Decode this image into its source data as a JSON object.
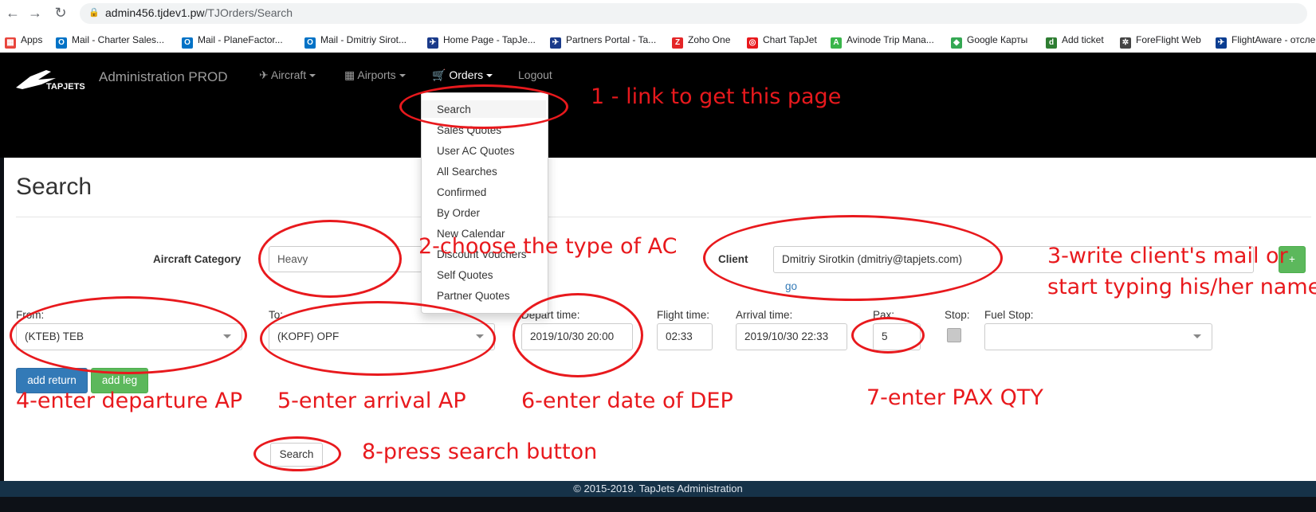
{
  "browser": {
    "url_host": "admin456.tjdev1.pw",
    "url_path": "/TJOrders/Search",
    "bookmarks": [
      {
        "label": "Apps",
        "icon": "apps-grid-icon",
        "color": "#e8453c"
      },
      {
        "label": "Mail - Charter Sales...",
        "icon": "outlook-icon",
        "color": "#0072c6"
      },
      {
        "label": "Mail - PlaneFactor...",
        "icon": "outlook-icon",
        "color": "#0072c6"
      },
      {
        "label": "Mail - Dmitriy Sirot...",
        "icon": "outlook-icon",
        "color": "#0072c6"
      },
      {
        "label": "Home Page - TapJe...",
        "icon": "tapjets-icon",
        "color": "#1a3a8a"
      },
      {
        "label": "Partners Portal - Ta...",
        "icon": "tapjets-icon",
        "color": "#1a3a8a"
      },
      {
        "label": "Zoho One",
        "icon": "zoho-icon",
        "color": "#e42527"
      },
      {
        "label": "Chart TapJet",
        "icon": "chart-target-icon",
        "color": "#e8191d"
      },
      {
        "label": "Avinode Trip Mana...",
        "icon": "avinode-icon",
        "color": "#39b54a"
      },
      {
        "label": "Google Карты",
        "icon": "google-maps-icon",
        "color": "#34a853"
      },
      {
        "label": "Add ticket",
        "icon": "ticket-icon",
        "color": "#2e7d32"
      },
      {
        "label": "ForeFlight Web",
        "icon": "foreflight-gear-icon",
        "color": "#444444"
      },
      {
        "label": "FlightAware - отсле",
        "icon": "flightaware-plane-icon",
        "color": "#0a3d91"
      }
    ]
  },
  "app": {
    "brand": "TAPJETS",
    "title": "Administration PROD",
    "nav": [
      {
        "label": "Aircraft",
        "icon": "plane-icon"
      },
      {
        "label": "Airports",
        "icon": "building-icon"
      },
      {
        "label": "Orders",
        "icon": "cart-icon"
      },
      {
        "label": "Logout",
        "icon": ""
      }
    ],
    "orders_menu": [
      "Search",
      "Sales Quotes",
      "User AC Quotes",
      "All Searches",
      "Confirmed",
      "By Order",
      "New Calendar",
      "Discount Vouchers",
      "Self Quotes",
      "Partner Quotes"
    ]
  },
  "search": {
    "title": "Search",
    "aircraft_category_label": "Aircraft Category",
    "aircraft_category_value": "Heavy",
    "client_label": "Client",
    "client_value": "Dmitriy Sirotkin (dmitriy@tapjets.com)",
    "client_go": "go",
    "add_client_label": "+",
    "from_label": "From:",
    "from_value": "(KTEB) TEB",
    "to_label": "To:",
    "to_value": "(KOPF) OPF",
    "depart_label": "Depart time:",
    "depart_value": "2019/10/30 20:00",
    "flight_time_label": "Flight time:",
    "flight_time_value": "02:33",
    "arrival_label": "Arrival time:",
    "arrival_value": "2019/10/30 22:33",
    "pax_label": "Pax:",
    "pax_value": "5",
    "stop_label": "Stop:",
    "fuel_stop_label": "Fuel Stop:",
    "fuel_stop_value": "",
    "add_return_label": "add return",
    "add_leg_label": "add leg",
    "search_button_label": "Search"
  },
  "footer": "© 2015-2019. TapJets Administration",
  "annotations": {
    "a1": "1 - link to get this page",
    "a2": "2-choose the type of AC",
    "a3_line1": "3-write client's mail or",
    "a3_line2": "start typing his/her name",
    "a4": "4-enter departure AP",
    "a5": "5-enter arrival AP",
    "a6": "6-enter date of DEP",
    "a7": "7-enter PAX QTY",
    "a8": "8-press search button",
    "color": "#e8191d"
  }
}
